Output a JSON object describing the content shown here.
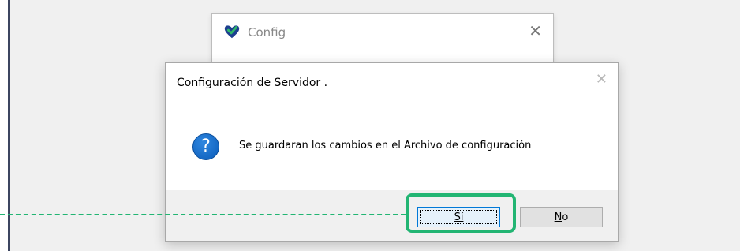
{
  "background_window": {
    "title": "Config",
    "close_glyph": "✕",
    "logo_icon": "check-heart-logo",
    "logo_colors": [
      "#1d3f8f",
      "#2eb86a"
    ]
  },
  "dialog": {
    "title": "Configuración de Servidor .",
    "close_glyph": "✕",
    "icon": "question-icon",
    "icon_glyph": "?",
    "message": "Se guardaran los cambios en el Archivo de configuración",
    "buttons": {
      "yes_label": "Sí",
      "no_label": "No"
    }
  },
  "annotation": {
    "highlight_color": "#22b573",
    "target": "yes-button"
  }
}
